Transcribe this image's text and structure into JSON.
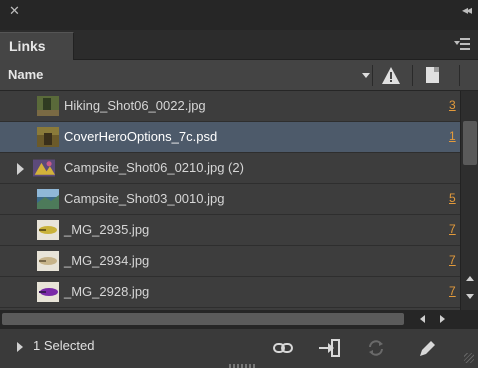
{
  "panel": {
    "tab_label": "Links"
  },
  "header": {
    "name_label": "Name"
  },
  "rows": [
    {
      "name": "Hiking_Shot06_0022.jpg",
      "page": "3",
      "thumb": "hiking",
      "selected": false,
      "expandable": false
    },
    {
      "name": "CoverHeroOptions_7c.psd",
      "page": "1",
      "thumb": "cover",
      "selected": true,
      "expandable": false
    },
    {
      "name": "Campsite_Shot06_0210.jpg (2)",
      "page": "",
      "thumb": "campsite",
      "selected": false,
      "expandable": true
    },
    {
      "name": "Campsite_Shot03_0010.jpg",
      "page": "5",
      "thumb": "campsite2",
      "selected": false,
      "expandable": false
    },
    {
      "name": "_MG_2935.jpg",
      "page": "7",
      "thumb": "mg-yellow",
      "selected": false,
      "expandable": false
    },
    {
      "name": "_MG_2934.jpg",
      "page": "7",
      "thumb": "mg-tan",
      "selected": false,
      "expandable": false
    },
    {
      "name": "_MG_2928.jpg",
      "page": "7",
      "thumb": "mg-purple",
      "selected": false,
      "expandable": false
    }
  ],
  "footer": {
    "status": "1 Selected"
  },
  "icons": {
    "close": "close-icon",
    "collapse": "collapse-icon",
    "panel_menu": "panel-menu-icon",
    "sort": "sort-arrow-icon",
    "warning": "warning-icon",
    "page": "page-icon",
    "relink": "relink-icon",
    "goto_link": "go-to-link-icon",
    "update": "update-link-icon",
    "edit": "edit-original-icon"
  },
  "colors": {
    "page_number": "#e39a3b",
    "selection": "#4d5a6a",
    "panel_bg": "#3a3a3a"
  }
}
